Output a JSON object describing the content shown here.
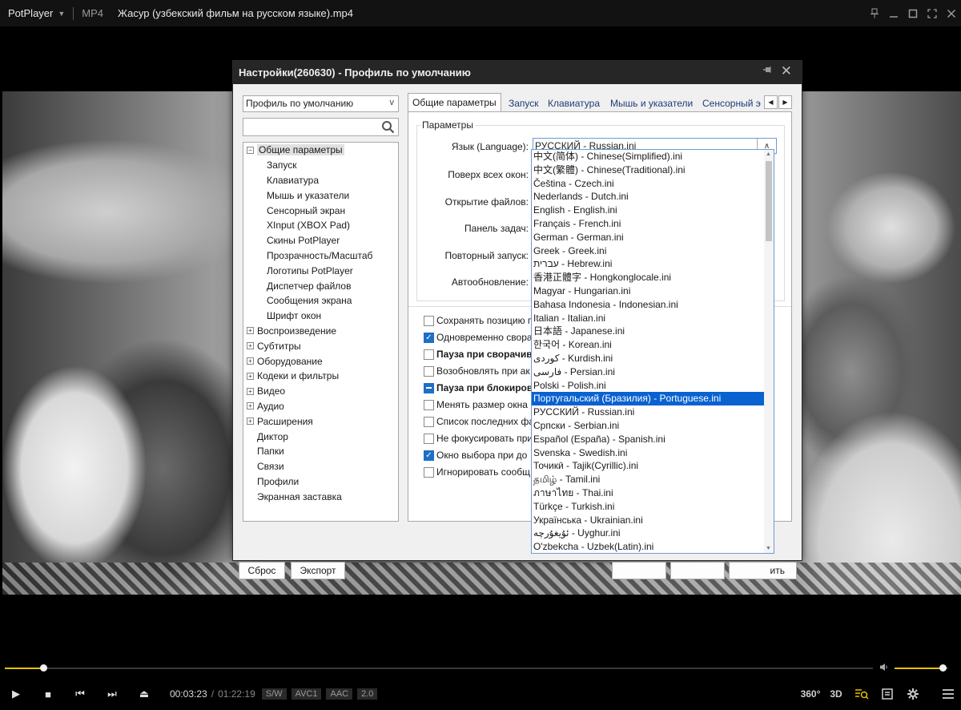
{
  "player": {
    "brand": "PotPlayer",
    "format": "MP4",
    "file_title": "Жасур (узбекский фильм на русском языке).mp4",
    "progress_fraction": 0.044,
    "volume_fraction": 0.9,
    "current_time": "00:03:23",
    "total_time": "01:22:19",
    "badges": [
      "S/W",
      "AVC1",
      "AAC",
      "2.0"
    ],
    "right_icons": [
      "360°",
      "3D"
    ]
  },
  "dialog": {
    "title": "Настройки(260630) - Профиль по умолчанию",
    "profile_select": "Профиль по умолчанию",
    "search_placeholder": "",
    "tree": [
      {
        "label": "Общие параметры",
        "expander": "−",
        "selected": true
      },
      {
        "label": "Запуск",
        "child": true
      },
      {
        "label": "Клавиатура",
        "child": true
      },
      {
        "label": "Мышь и указатели",
        "child": true
      },
      {
        "label": "Сенсорный экран",
        "child": true
      },
      {
        "label": "XInput (XBOX Pad)",
        "child": true
      },
      {
        "label": "Скины PotPlayer",
        "child": true
      },
      {
        "label": "Прозрачность/Масштаб",
        "child": true
      },
      {
        "label": "Логотипы PotPlayer",
        "child": true
      },
      {
        "label": "Диспетчер файлов",
        "child": true
      },
      {
        "label": "Сообщения экрана",
        "child": true
      },
      {
        "label": "Шрифт окон",
        "child": true
      },
      {
        "label": "Воспроизведение",
        "expander": "+"
      },
      {
        "label": "Субтитры",
        "expander": "+"
      },
      {
        "label": "Оборудование",
        "expander": "+"
      },
      {
        "label": "Кодеки и фильтры",
        "expander": "+"
      },
      {
        "label": "Видео",
        "expander": "+"
      },
      {
        "label": "Аудио",
        "expander": "+"
      },
      {
        "label": "Расширения",
        "expander": "+"
      },
      {
        "label": "Диктор"
      },
      {
        "label": "Папки"
      },
      {
        "label": "Связи"
      },
      {
        "label": "Профили"
      },
      {
        "label": "Экранная заставка"
      }
    ],
    "tabs": [
      "Общие параметры",
      "Запуск",
      "Клавиатура",
      "Мышь и указатели",
      "Сенсорный э"
    ],
    "group_label": "Параметры",
    "fields": {
      "language_label": "Язык (Language):",
      "language_value": "РУССКИЙ - Russian.ini",
      "ontop_label": "Поверх всех окон:",
      "openfiles_label": "Открытие файлов:",
      "taskbar_label": "Панель задач:",
      "rerun_label": "Повторный запуск:",
      "autoupdate_label": "Автообновление:"
    },
    "checkboxes": [
      {
        "label": "Сохранять позицию п",
        "state": "off",
        "bold": false
      },
      {
        "label": "Одновременно сворa",
        "state": "on",
        "bold": false
      },
      {
        "label": "Пауза при сворачив",
        "state": "off",
        "bold": true
      },
      {
        "label": "Возобновлять при ак",
        "state": "off",
        "bold": false
      },
      {
        "label": "Пауза при блокиров",
        "state": "partial",
        "bold": true
      },
      {
        "label": "Менять размер окна",
        "state": "off",
        "bold": false
      },
      {
        "label": "Список последних фа",
        "state": "off",
        "bold": false
      },
      {
        "label": "Не фокусировать при",
        "state": "off",
        "bold": false
      },
      {
        "label": "Окно выбора при до",
        "state": "on",
        "bold": false
      },
      {
        "label": "Игнорировать сообщ",
        "state": "off",
        "bold": false
      }
    ],
    "buttons": {
      "reset": "Сброс",
      "export": "Экспорт",
      "apply_partial": "ить"
    },
    "language_options": [
      "中文(简体) - Chinese(Simplified).ini",
      "中文(繁體) - Chinese(Traditional).ini",
      "Čeština - Czech.ini",
      "Nederlands - Dutch.ini",
      "English - English.ini",
      "Français - French.ini",
      "German - German.ini",
      "Greek - Greek.ini",
      "עברית - Hebrew.ini",
      "香港正體字 - Hongkonglocale.ini",
      "Magyar - Hungarian.ini",
      "Bahasa Indonesia - Indonesian.ini",
      "Italian - Italian.ini",
      "日本語 - Japanese.ini",
      "한국어 - Korean.ini",
      "كوردى - Kurdish.ini",
      "فارسی  - Persian.ini",
      "Polski - Polish.ini",
      "Португальский (Бразилия) - Portuguese.ini",
      "РУССКИЙ - Russian.ini",
      "Српски - Serbian.ini",
      "Español (España) - Spanish.ini",
      "Svenska - Swedish.ini",
      "Точикӣ - Tajik(Cyrillic).ini",
      "தமிழ் - Tamil.ini",
      "ภาษาไทย - Thai.ini",
      "Türkçe - Turkish.ini",
      "Українська - Ukrainian.ini",
      "ئۇيغۇرچە - Uyghur.ini",
      "O'zbekcha - Uzbek(Latin).ini"
    ],
    "selected_language_index": 18
  }
}
